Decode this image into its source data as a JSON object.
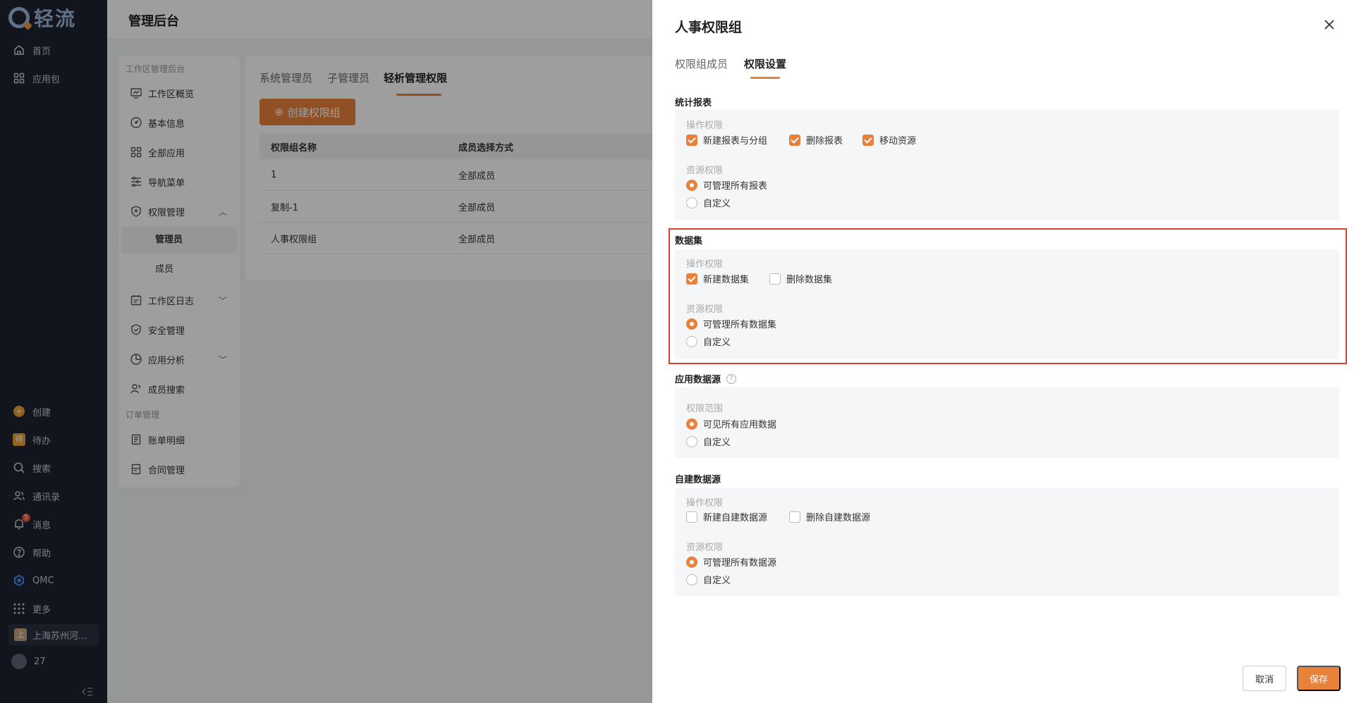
{
  "app": {
    "logo_text": "轻流"
  },
  "nav": {
    "home": "首页",
    "apps": "应用包",
    "create": "创建",
    "todo": "待办",
    "todo_icon": "待",
    "search": "搜索",
    "contacts": "通讯录",
    "messages": "消息",
    "messages_badge": "5",
    "help": "帮助",
    "qmc": "QMC",
    "more": "更多",
    "org_name": "上海苏州河...",
    "org_icon": "上",
    "user_id": "27"
  },
  "topbar": {
    "title": "管理后台"
  },
  "side2": {
    "group1": "工作区管理后台",
    "overview": "工作区概览",
    "basic_info": "基本信息",
    "all_apps": "全部应用",
    "nav_menu": "导航菜单",
    "permission": "权限管理",
    "admin": "管理员",
    "member": "成员",
    "log": "工作区日志",
    "security": "安全管理",
    "analysis": "应用分析",
    "member_search": "成员搜索",
    "group2": "订单管理",
    "bill": "账单明细",
    "contract": "合同管理"
  },
  "content": {
    "tabs": [
      "系统管理员",
      "子管理员",
      "轻析管理权限"
    ],
    "create_btn": "创建权限组",
    "columns": [
      "权限组名称",
      "成员选择方式"
    ],
    "rows": [
      [
        "1",
        "全部成员"
      ],
      [
        "复制-1",
        "全部成员"
      ],
      [
        "人事权限组",
        "全部成员"
      ]
    ]
  },
  "drawer": {
    "title": "人事权限组",
    "tabs": [
      "权限组成员",
      "权限设置"
    ],
    "sections": {
      "reports": {
        "title": "统计报表",
        "op_label": "操作权限",
        "op1": "新建报表与分组",
        "op2": "删除报表",
        "op3": "移动资源",
        "res_label": "资源权限",
        "res1": "可管理所有报表",
        "res2": "自定义"
      },
      "datasets": {
        "title": "数据集",
        "op_label": "操作权限",
        "op1": "新建数据集",
        "op2": "删除数据集",
        "res_label": "资源权限",
        "res1": "可管理所有数据集",
        "res2": "自定义"
      },
      "app_sources": {
        "title": "应用数据源",
        "help_icon": "?",
        "scope_label": "权限范围",
        "res1": "可见所有应用数据",
        "res2": "自定义"
      },
      "custom_sources": {
        "title": "自建数据源",
        "op_label": "操作权限",
        "op1": "新建自建数据源",
        "op2": "删除自建数据源",
        "res_label": "资源权限",
        "res1": "可管理所有数据源",
        "res2": "自定义"
      }
    },
    "cancel": "取消",
    "save": "保存"
  },
  "colors": {
    "accent": "#e8823a",
    "highlight": "#d9412f",
    "nav_bg": "#1d2230"
  }
}
